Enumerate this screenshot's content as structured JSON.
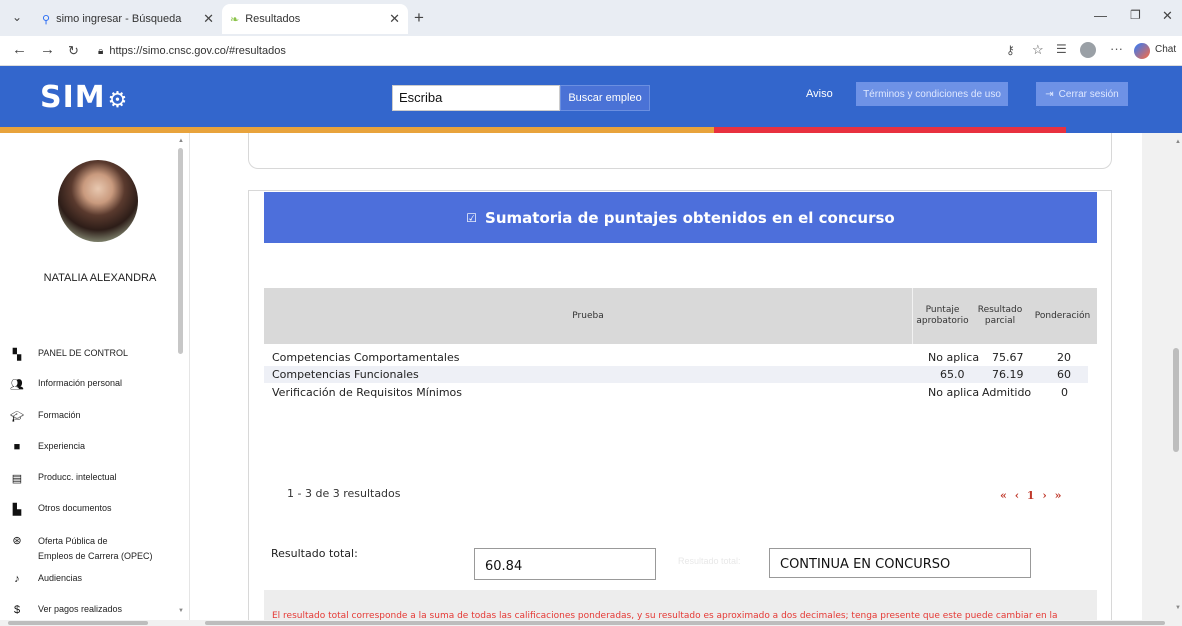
{
  "browser": {
    "tabs": [
      {
        "label": "simo ingresar - Búsqueda"
      },
      {
        "label": "Resultados"
      }
    ],
    "url": "https://simo.cnsc.gov.co/#resultados",
    "chat_label": "Chat"
  },
  "header": {
    "logo": "SIM",
    "search_value": "Escriba",
    "search_button": "Buscar empleo",
    "aviso": "Aviso",
    "terms": "Términos y condiciones de uso",
    "logout": "Cerrar sesión",
    "accent_colors": [
      "#e8a33c",
      "#e8313f",
      "#3366cc"
    ]
  },
  "sidebar": {
    "user_name": "NATALIA ALEXANDRA",
    "items": [
      {
        "label": "PANEL DE CONTROL",
        "icon": "dashboard-icon"
      },
      {
        "label": "Información personal",
        "icon": "people-icon"
      },
      {
        "label": "Formación",
        "icon": "graduation-icon"
      },
      {
        "label": "Experiencia",
        "icon": "briefcase-icon"
      },
      {
        "label": "Producc. intelectual",
        "icon": "publication-icon"
      },
      {
        "label": "Otros documentos",
        "icon": "document-icon"
      },
      {
        "label": "Oferta Pública de",
        "label2": "Empleos de Carrera (OPEC)",
        "icon": "globe-icon"
      },
      {
        "label": "Audiencias",
        "icon": "audience-icon"
      },
      {
        "label": "Ver pagos realizados",
        "icon": "dollar-icon"
      }
    ]
  },
  "main": {
    "banner_title": "Sumatoria de puntajes obtenidos en el concurso",
    "table": {
      "headers": [
        "Prueba",
        "Puntaje aprobatorio",
        "Resultado parcial",
        "Ponderación"
      ],
      "rows": [
        [
          "Competencias Comportamentales",
          "No aplica",
          "75.67",
          "20"
        ],
        [
          "Competencias Funcionales",
          "65.0",
          "76.19",
          "60"
        ],
        [
          "Verificación de Requisitos Mínimos",
          "No aplica",
          "Admitido",
          "0"
        ]
      ]
    },
    "pager_info": "1 - 3 de 3 resultados",
    "pager_controls": "« ‹ 1 › »",
    "result_label": "Resultado total:",
    "result_value": "60.84",
    "result_ghost": "Resultado total:",
    "result_status": "CONTINUA EN CONCURSO",
    "note": "El resultado total corresponde a la suma de todas las calificaciones ponderadas, y su resultado es aproximado a dos decimales; tenga presente que este puede cambiar en la"
  }
}
